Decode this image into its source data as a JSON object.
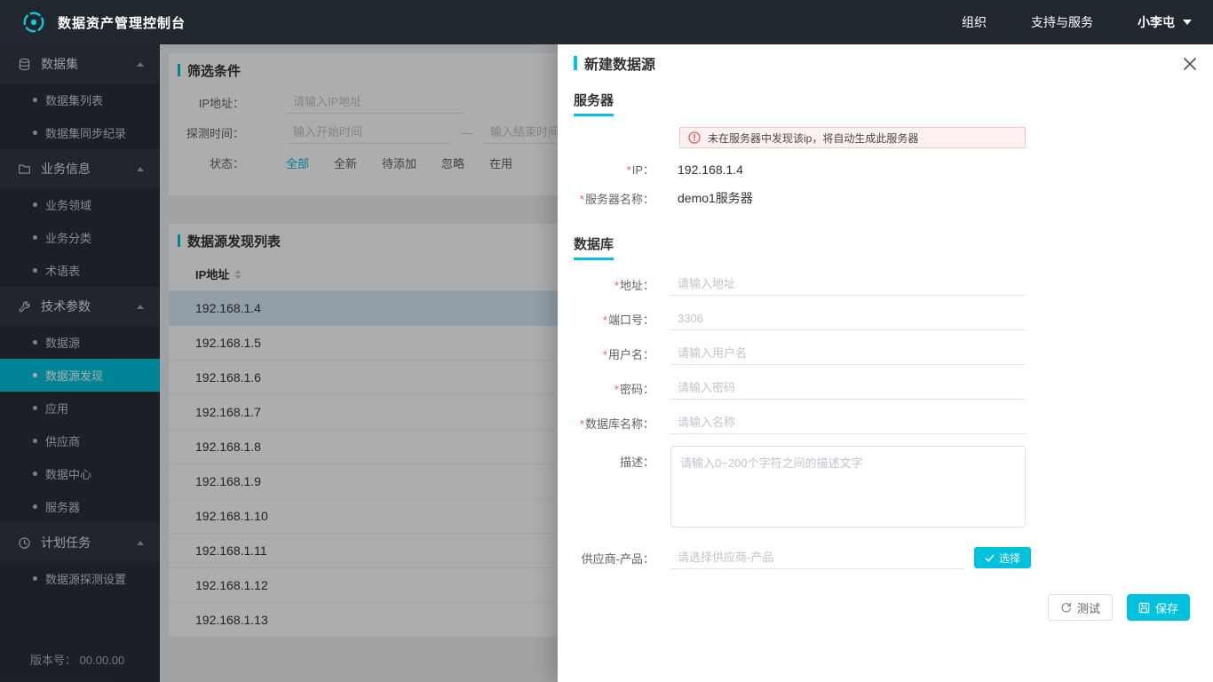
{
  "colors": {
    "accent": "#00c1de",
    "topbar_bg": "#21272f",
    "sidebar_bg": "#29303a"
  },
  "topbar": {
    "title": "数据资产管理控制台",
    "nav": [
      {
        "label": "组织"
      },
      {
        "label": "支持与服务"
      }
    ],
    "user": {
      "name": "小李屯"
    }
  },
  "sidebar": {
    "groups": [
      {
        "label": "数据集",
        "icon": "dataset-icon",
        "items": [
          {
            "label": "数据集列表"
          },
          {
            "label": "数据集同步纪录"
          }
        ]
      },
      {
        "label": "业务信息",
        "icon": "business-icon",
        "items": [
          {
            "label": "业务领域"
          },
          {
            "label": "业务分类"
          },
          {
            "label": "术语表"
          }
        ]
      },
      {
        "label": "技术参数",
        "icon": "tech-icon",
        "items": [
          {
            "label": "数据源"
          },
          {
            "label": "数据源发现",
            "active": true
          },
          {
            "label": "应用"
          },
          {
            "label": "供应商"
          },
          {
            "label": "数据中心"
          },
          {
            "label": "服务器"
          }
        ]
      },
      {
        "label": "计划任务",
        "icon": "task-icon",
        "items": [
          {
            "label": "数据源探测设置"
          }
        ]
      }
    ],
    "version_label": "版本号：",
    "version": "00.00.00"
  },
  "filter": {
    "title": "筛选条件",
    "ip_label": "IP地址：",
    "ip_placeholder": "请输入IP地址",
    "time_label": "探测时间：",
    "time_start_placeholder": "输入开始时间",
    "time_separator": "—",
    "time_end_placeholder": "输入结束时间",
    "status_label": "状态：",
    "status_options": [
      "全部",
      "全新",
      "待添加",
      "忽略",
      "在用"
    ],
    "status_active": "全部"
  },
  "list": {
    "title": "数据源发现列表",
    "column": "IP地址",
    "selected": "192.168.1.4",
    "rows": [
      "192.168.1.4",
      "192.168.1.5",
      "192.168.1.6",
      "192.168.1.7",
      "192.168.1.8",
      "192.168.1.9",
      "192.168.1.10",
      "192.168.1.11",
      "192.168.1.12",
      "192.168.1.13"
    ]
  },
  "drawer": {
    "title": "新建数据源",
    "required_mark": "*",
    "server": {
      "section": "服务器",
      "alert": "未在服务器中发现该ip，将自动生成此服务器",
      "ip_label": "IP：",
      "ip_value": "192.168.1.4",
      "name_label": "服务器名称：",
      "name_value": "demo1服务器"
    },
    "db": {
      "section": "数据库",
      "address_label": "地址：",
      "address_ph": "请输入地址",
      "port_label": "端口号：",
      "port_ph": "3306",
      "user_label": "用户名：",
      "user_ph": "请输入用户名",
      "password_label": "密码：",
      "password_ph": "请输入密码",
      "dbname_label": "数据库名称：",
      "dbname_ph": "请输入名称",
      "desc_label": "描述：",
      "desc_ph": "请输入0~200个字符之间的描述文字",
      "vendor_label": "供应商-产品：",
      "vendor_ph": "请选择供应商-产品",
      "select_button": "选择"
    },
    "footer": {
      "test": "测试",
      "save": "保存"
    }
  }
}
